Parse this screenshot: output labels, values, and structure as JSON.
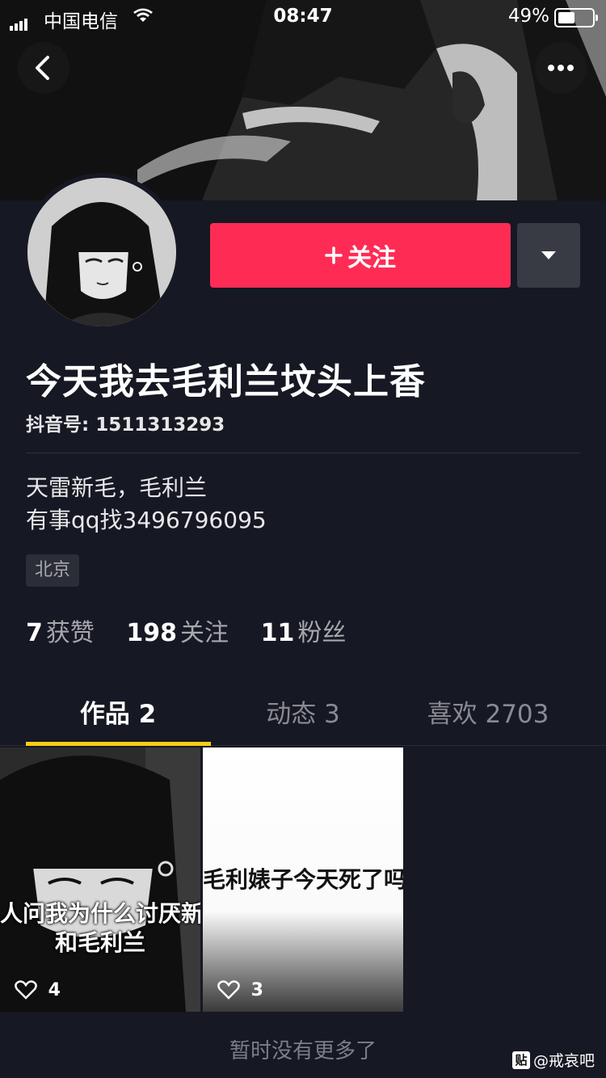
{
  "status_bar": {
    "carrier": "中国电信",
    "time": "08:47",
    "battery_percent": "49%",
    "battery_level": 0.49
  },
  "header": {
    "back_icon": "chevron-left-icon",
    "more_icon": "more-dots-icon"
  },
  "profile": {
    "follow_label": "关注",
    "nickname": "今天我去毛利兰坟头上香",
    "douyin_id": "抖音号: 1511313293",
    "bio_line1": "天雷新毛，毛利兰",
    "bio_line2": "有事qq找3496796095",
    "location_tag": "北京",
    "stats": {
      "likes_count": "7",
      "likes_label": "获赞",
      "following_count": "198",
      "following_label": "关注",
      "followers_count": "11",
      "followers_label": "粉丝"
    }
  },
  "tabs": [
    {
      "label": "作品 2"
    },
    {
      "label": "动态 3"
    },
    {
      "label": "喜欢 2703"
    }
  ],
  "videos": [
    {
      "caption_line1": "人问我为什么讨厌新",
      "caption_line2": "和毛利兰",
      "likes": "4"
    },
    {
      "caption_line1": "毛利婊子今天死了吗",
      "likes": "3"
    }
  ],
  "footer": {
    "empty_text": "暂时没有更多了",
    "watermark": "@戒哀吧",
    "watermark_badge": "贴"
  },
  "colors": {
    "background": "#161823",
    "follow_button": "#fe2c55",
    "tab_indicator": "#face15"
  }
}
